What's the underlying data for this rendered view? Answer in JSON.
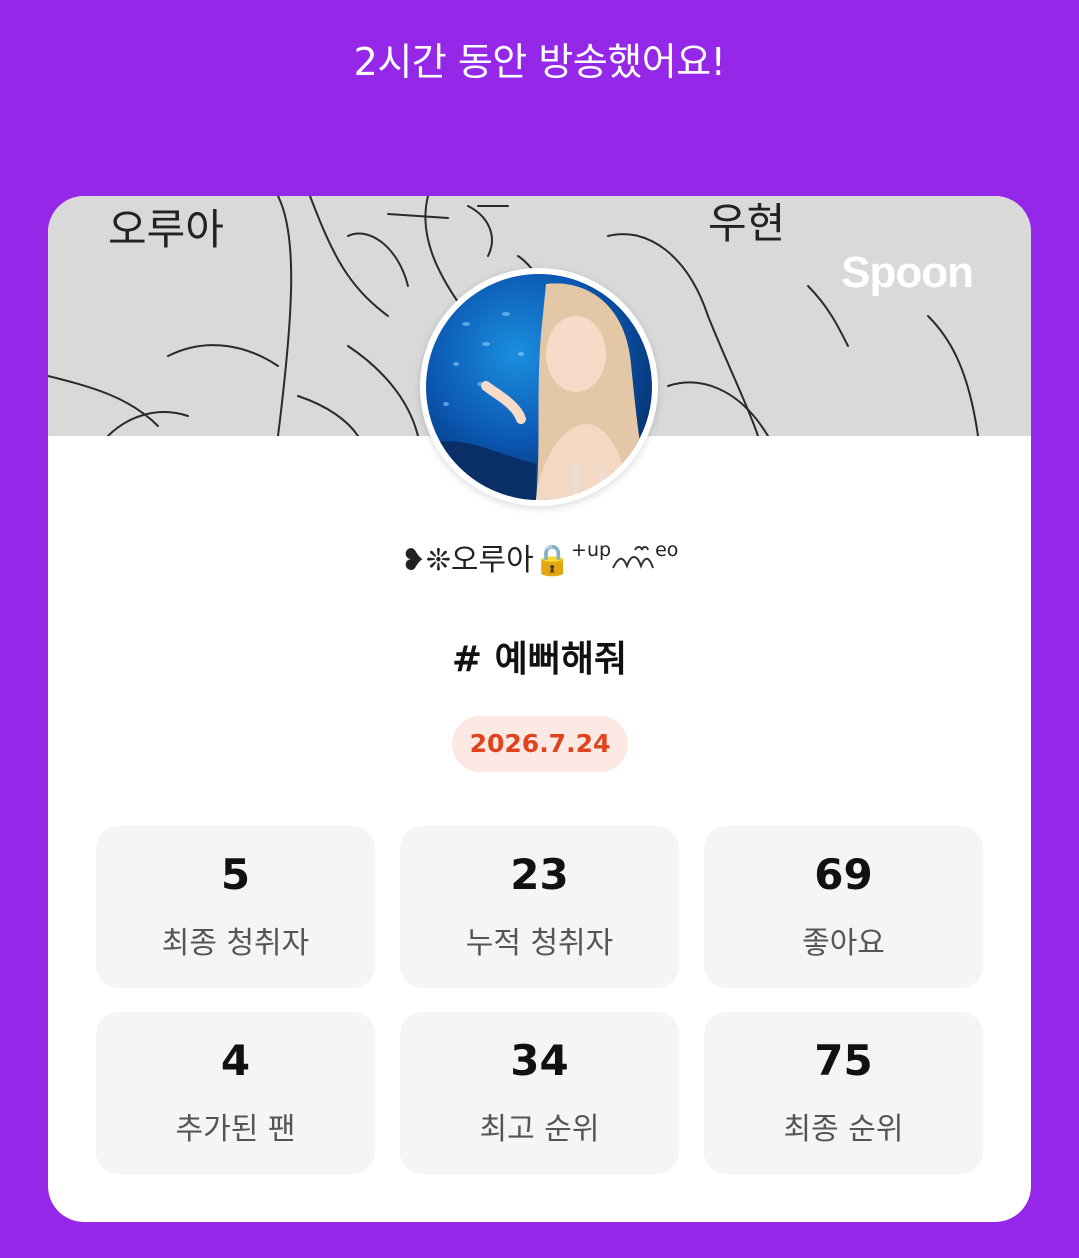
{
  "headline": "2시간 동안 방송했어요!",
  "cover": {
    "sketch_text_left": "오루아",
    "sketch_text_right": "우현",
    "logo": "Spoon"
  },
  "profile": {
    "username_prefix": "❥❊오루아",
    "lock_icon": "🔒",
    "username_sup": "+up",
    "username_suffix": "eo"
  },
  "broadcast": {
    "title": "# 예뻐해줘",
    "date": "2026.7.24"
  },
  "stats": [
    {
      "value": "5",
      "label": "최종 청취자"
    },
    {
      "value": "23",
      "label": "누적 청취자"
    },
    {
      "value": "69",
      "label": "좋아요"
    },
    {
      "value": "4",
      "label": "추가된 팬"
    },
    {
      "value": "34",
      "label": "최고 순위"
    },
    {
      "value": "75",
      "label": "최종 순위"
    }
  ],
  "colors": {
    "background": "#9427e8",
    "card": "#ffffff",
    "cover": "#d9d9d9",
    "date_badge_bg": "#fde9e4",
    "date_badge_text": "#e0441e",
    "stat_bg": "#f5f5f5"
  }
}
